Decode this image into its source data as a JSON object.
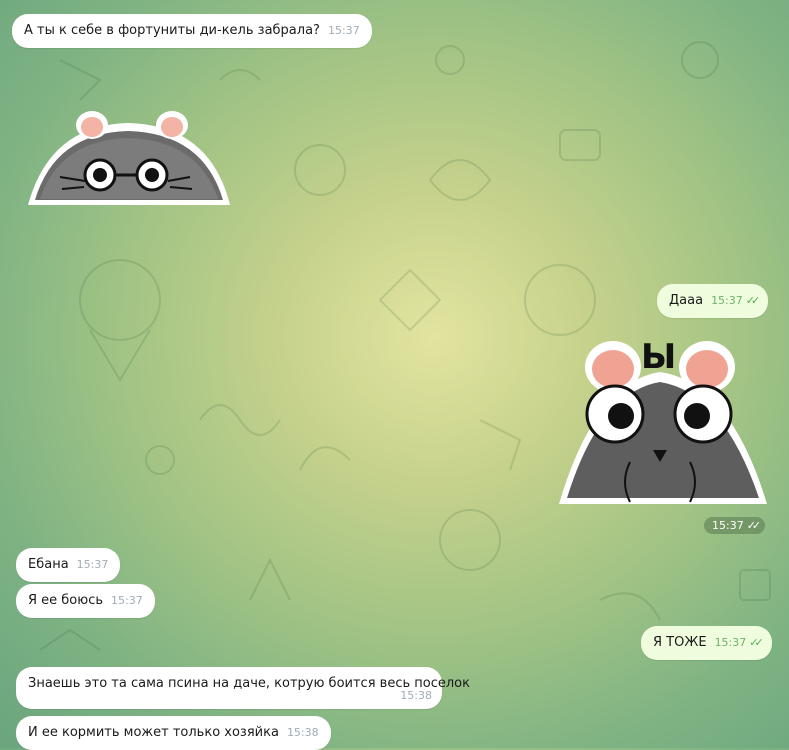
{
  "messages": [
    {
      "text": "А ты к себе в фортуниты ди-кель забрала?",
      "time": "15:37"
    },
    {
      "text": "Дааа",
      "time": "15:37"
    },
    {
      "time": "15:37"
    },
    {
      "text": "Ебана",
      "time": "15:37"
    },
    {
      "text": "Я ее боюсь",
      "time": "15:37"
    },
    {
      "text": "Я ТОЖЕ",
      "time": "15:37"
    },
    {
      "text": "Знаешь это та сама псина на даче, котрую боится весь поселок",
      "time": "15:38"
    },
    {
      "text": "И ее кормить может только хозяйка",
      "time": "15:38"
    }
  ],
  "stickers": {
    "rat_label": "Ы"
  },
  "icons": {
    "read": "double-check-icon"
  },
  "colors": {
    "incoming": "#ffffff",
    "outgoing": "#effdde",
    "check": "#4fae4e"
  }
}
